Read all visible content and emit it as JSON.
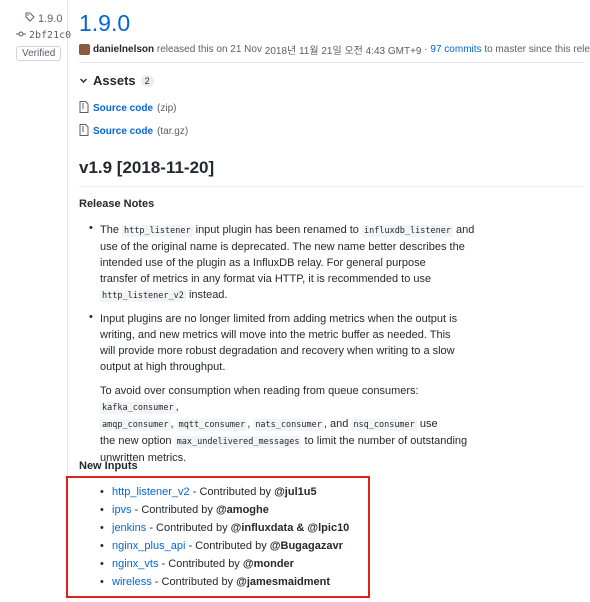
{
  "sidebar": {
    "tag": "1.9.0",
    "commit": "2bf21c0",
    "verified": "Verified"
  },
  "release": {
    "title": "1.9.0",
    "author": "danielnelson",
    "released_text": "released this on 21 Nov",
    "date_detail": "2018년 11월 21일 오전 4:43 GMT+9",
    "dot": "·",
    "commits_link": "97 commits",
    "commits_suffix": "to master since this release"
  },
  "assets": {
    "title": "Assets",
    "count": "2",
    "items": [
      {
        "label": "Source code",
        "format": "(zip)"
      },
      {
        "label": "Source code",
        "format": "(tar.gz)"
      }
    ]
  },
  "notes": {
    "version_heading": "v1.9 [2018-11-20]",
    "release_notes_title": "Release Notes",
    "b1_pre": "The",
    "b1_code1": "http_listener",
    "b1_mid": "input plugin has been renamed to",
    "b1_code2": "influxdb_listener",
    "b1_and": "and",
    "b1_l2": "use of the original name is deprecated. The new name better describes the",
    "b1_l3": "intended use of the plugin as a InfluxDB relay. For general purpose",
    "b1_l4": "transfer of metrics in any format via HTTP, it is recommended to use",
    "b1_code3": "http_listener_v2",
    "b1_end": "instead.",
    "b2_l1": "Input plugins are no longer limited from adding metrics when the output is",
    "b2_l2": "writing, and new metrics will move into the metric buffer as needed. This",
    "b2_l3": "will provide more robust degradation and recovery when writing to a slow",
    "b2_l4": "output at high throughput.",
    "p_l1": "To avoid over consumption when reading from queue consumers:",
    "p_code1": "kafka_consumer",
    "p_comma": ",",
    "p_code2": "amqp_consumer",
    "p_code3": "mqtt_consumer",
    "p_code4": "nats_consumer",
    "p_and": ", and",
    "p_code5": "nsq_consumer",
    "p_use": "use",
    "p_l3_pre": "the new option",
    "p_code6": "max_undelivered_messages",
    "p_l3_post": "to limit the number of outstanding",
    "p_l4": "unwritten metrics.",
    "new_inputs_title": "New Inputs"
  },
  "new_inputs": [
    {
      "plugin": "http_listener_v2",
      "by": "- Contributed by",
      "handle": "@jul1u5",
      "extra": ""
    },
    {
      "plugin": "ipvs",
      "by": "- Contributed by",
      "handle": "@amoghe",
      "extra": ""
    },
    {
      "plugin": "jenkins",
      "by": "- Contributed by",
      "handle": "@influxdata",
      "extra": "& @lpic10"
    },
    {
      "plugin": "nginx_plus_api",
      "by": "- Contributed by",
      "handle": "@Bugagazavr",
      "extra": ""
    },
    {
      "plugin": "nginx_vts",
      "by": "- Contributed by",
      "handle": "@monder",
      "extra": ""
    },
    {
      "plugin": "wireless",
      "by": "- Contributed by",
      "handle": "@jamesmaidment",
      "extra": ""
    }
  ],
  "colors": {
    "link": "#0366d6",
    "highlight": "#e0201b"
  }
}
